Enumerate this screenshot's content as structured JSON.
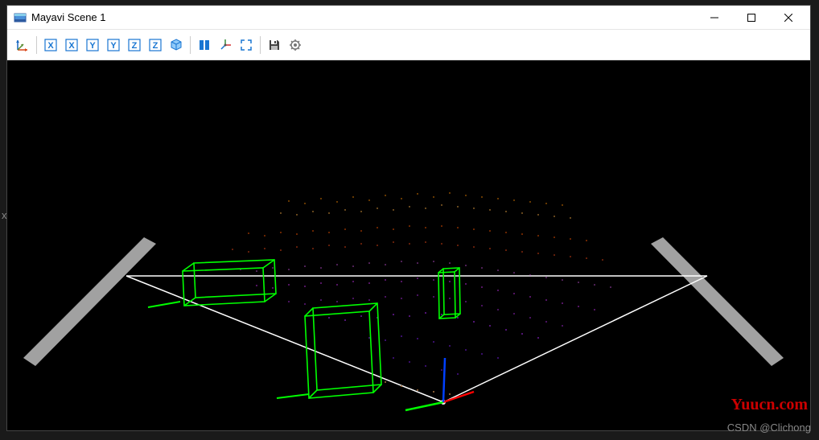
{
  "window": {
    "title": "Mayavi Scene 1"
  },
  "toolbar": {
    "view_reset": "reset-view",
    "x_plus": "X",
    "x_minus": "X",
    "y_plus": "Y",
    "y_minus": "Y",
    "z_plus": "Z",
    "z_minus": "Z",
    "isometric": "iso",
    "parallel": "parallel",
    "axes": "axes",
    "fullscreen": "fullscreen",
    "save": "save",
    "configure": "configure"
  },
  "watermarks": {
    "site": "Yuucn.com",
    "author": "CSDN @Clichong"
  },
  "axis_label": "x",
  "scene": {
    "type": "3d-point-cloud",
    "bounding_boxes": 3,
    "box_color": "#00ff00",
    "frustum_color": "#ffffff",
    "axes_colors": {
      "x": "#ff0000",
      "y": "#00ff00",
      "z": "#0000ff"
    }
  }
}
